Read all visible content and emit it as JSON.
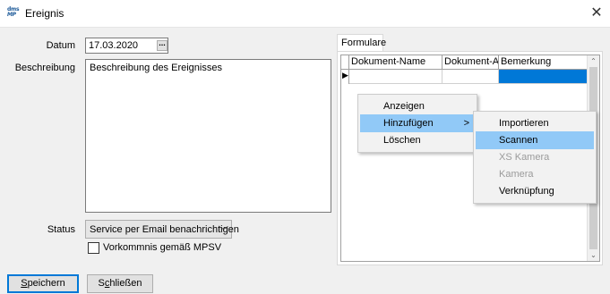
{
  "window": {
    "title": "Ereignis",
    "app_logo_top": "dms",
    "app_logo_bottom": "MP",
    "close_glyph": "✕"
  },
  "form": {
    "datum_label": "Datum",
    "datum_value": "17.03.2020",
    "datum_picker_glyph": "...",
    "beschreibung_label": "Beschreibung",
    "beschreibung_value": "Beschreibung des Ereignisses",
    "status_label": "Status",
    "status_value": "Service per Email benachrichtigen",
    "status_arrow": "﹀",
    "mpsv_checkbox_label": "Vorkommnis gemäß MPSV",
    "mpsv_checked": false
  },
  "tabs": [
    {
      "label": "Formulare",
      "active": true
    }
  ],
  "grid": {
    "columns": [
      "Dokument-Name",
      "Dokument-Art",
      "Bemerkung"
    ],
    "row_indicator": "▶",
    "scroll_up": "⌃",
    "scroll_down": "⌄"
  },
  "context_menu": {
    "items": [
      {
        "label": "Anzeigen",
        "highlighted": false,
        "disabled": false
      },
      {
        "label": "Hinzufügen",
        "highlighted": true,
        "disabled": false,
        "submenu": true,
        "arrow": ">"
      },
      {
        "label": "Löschen",
        "highlighted": false,
        "disabled": false
      }
    ]
  },
  "submenu": {
    "items": [
      {
        "label": "Importieren",
        "highlighted": false,
        "disabled": false
      },
      {
        "label": "Scannen",
        "highlighted": true,
        "disabled": false
      },
      {
        "label": "XS Kamera",
        "highlighted": false,
        "disabled": true
      },
      {
        "label": "Kamera",
        "highlighted": false,
        "disabled": true
      },
      {
        "label": "Verknüpfung",
        "highlighted": false,
        "disabled": false
      }
    ]
  },
  "buttons": {
    "save_mnemonic": "S",
    "save_rest": "peichern",
    "close_first": "S",
    "close_mnemonic": "c",
    "close_rest": "hließen"
  },
  "colors": {
    "highlight": "#91c9f7",
    "selected_cell": "#0078d7"
  }
}
